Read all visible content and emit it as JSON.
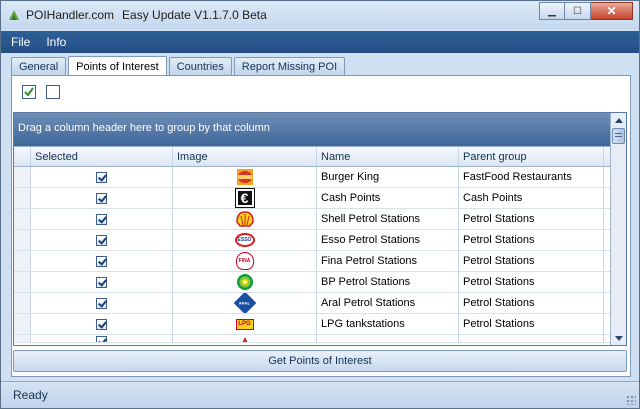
{
  "window": {
    "app_name": "POIHandler.com",
    "title": "Easy Update V1.1.7.0 Beta",
    "minimize": "▁",
    "maximize": "☐",
    "close": "✕"
  },
  "menu": {
    "items": [
      "File",
      "Info"
    ]
  },
  "tabs": [
    "General",
    "Points of Interest",
    "Countries",
    "Report Missing POI"
  ],
  "active_tab": "Points of Interest",
  "toolbar": {
    "check_all_icon": "check-all-icon",
    "uncheck_all_icon": "uncheck-all-icon"
  },
  "grid": {
    "group_panel_text": "Drag a column header here to group by that column",
    "columns": [
      "Selected",
      "Image",
      "Name",
      "Parent group"
    ],
    "rows": [
      {
        "selected": true,
        "image": "burger-king-logo",
        "name": "Burger King",
        "parent_group": "FastFood Restaurants"
      },
      {
        "selected": true,
        "image": "euro-logo",
        "name": "Cash Points",
        "parent_group": "Cash Points"
      },
      {
        "selected": true,
        "image": "shell-logo",
        "name": "Shell Petrol Stations",
        "parent_group": "Petrol Stations"
      },
      {
        "selected": true,
        "image": "esso-logo",
        "name": "Esso Petrol Stations",
        "parent_group": "Petrol Stations"
      },
      {
        "selected": true,
        "image": "fina-logo",
        "name": "Fina Petrol Stations",
        "parent_group": "Petrol Stations"
      },
      {
        "selected": true,
        "image": "bp-logo",
        "name": "BP Petrol Stations",
        "parent_group": "Petrol Stations"
      },
      {
        "selected": true,
        "image": "aral-logo",
        "name": "Aral Petrol Stations",
        "parent_group": "Petrol Stations"
      },
      {
        "selected": true,
        "image": "lpg-logo",
        "name": "LPG tankstations",
        "parent_group": "Petrol Stations"
      }
    ]
  },
  "logo_text": {
    "euro": "€",
    "esso": "ESSO",
    "fina": "FINA",
    "aral": "ARAL",
    "lpg": "LPG",
    "bk": "BURGER KING"
  },
  "button": {
    "get_poi": "Get Points of Interest"
  },
  "status": {
    "text": "Ready"
  },
  "colors": {
    "menubar": "#2e5f97",
    "accent": "#3f6699"
  }
}
